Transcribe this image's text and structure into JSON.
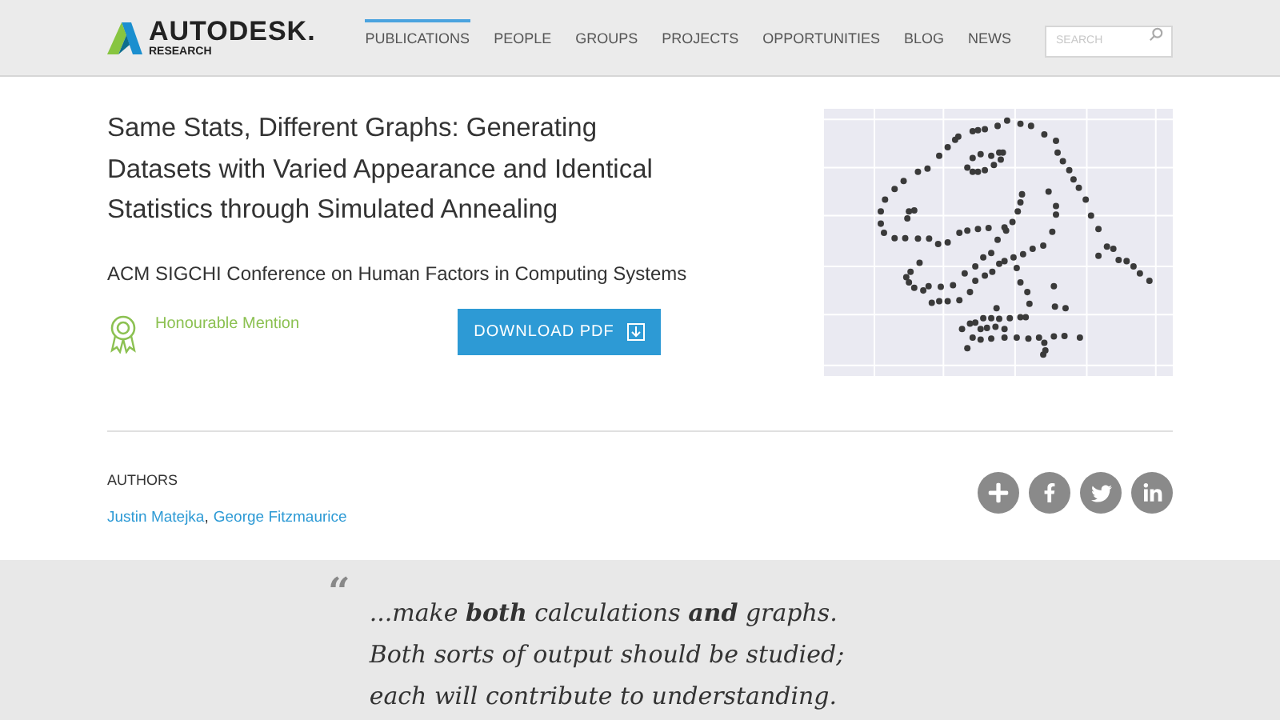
{
  "header": {
    "logo": {
      "wordmark": "AUTODESK.",
      "subtitle": "RESEARCH"
    },
    "nav": [
      {
        "label": "PUBLICATIONS",
        "selected": true
      },
      {
        "label": "PEOPLE",
        "selected": false
      },
      {
        "label": "GROUPS",
        "selected": false
      },
      {
        "label": "PROJECTS",
        "selected": false
      },
      {
        "label": "OPPORTUNITIES",
        "selected": false
      },
      {
        "label": "BLOG",
        "selected": false
      },
      {
        "label": "NEWS",
        "selected": false
      }
    ],
    "search": {
      "placeholder": "SEARCH"
    }
  },
  "publication": {
    "title": "Same Stats, Different Graphs: Generating Datasets with Varied Appearance and Identical Statistics through Simulated Annealing",
    "venue": "ACM SIGCHI Conference on Human Factors in Computing Systems",
    "award": "Honourable Mention",
    "download_button": "DOWNLOAD PDF"
  },
  "authors": {
    "heading": "AUTHORS",
    "names": [
      "Justin Matejka",
      "George Fitzmaurice"
    ],
    "separator": ","
  },
  "share": [
    {
      "kind": "plus"
    },
    {
      "kind": "facebook"
    },
    {
      "kind": "twitter"
    },
    {
      "kind": "linkedin"
    }
  ],
  "quote": {
    "mark": "“",
    "text": "...make **both** calculations **and** graphs. Both sorts of output should be studied; each will contribute to understanding."
  }
}
